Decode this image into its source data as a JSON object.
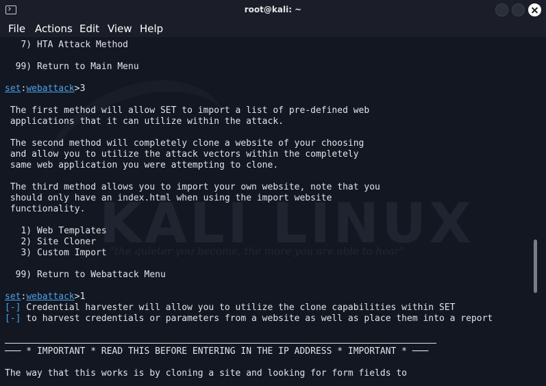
{
  "window": {
    "title": "root@kali: ~"
  },
  "menu": {
    "items": [
      "File",
      "Actions",
      "Edit",
      "View",
      "Help"
    ]
  },
  "watermark": {
    "logo": "KALI LINUX",
    "tagline": "\"the quieter you become, the more you are able to hear\""
  },
  "terminal": {
    "l00": "   7) HTA Attack Method",
    "l02": "  99) Return to Main Menu",
    "prompt_set": "set",
    "prompt_colon": ":",
    "prompt_module": "webattack",
    "prompt1_input": ">3",
    "l06": " The first method will allow SET to import a list of pre-defined web",
    "l07": " applications that it can utilize within the attack.",
    "l09": " The second method will completely clone a website of your choosing",
    "l10": " and allow you to utilize the attack vectors within the completely",
    "l11": " same web application you were attempting to clone.",
    "l13": " The third method allows you to import your own website, note that you",
    "l14": " should only have an index.html when using the import website",
    "l15": " functionality.",
    "l17": "   1) Web Templates",
    "l18": "   2) Site Cloner",
    "l19": "   3) Custom Import",
    "l21": "  99) Return to Webattack Menu",
    "prompt2_input": ">1",
    "bracket": "[-]",
    "l24": " Credential harvester will allow you to utilize the clone capabilities within SET",
    "l25": " to harvest credentials or parameters from a website as well as place them into a report",
    "l28": "─── * IMPORTANT * READ THIS BEFORE ENTERING IN THE IP ADDRESS * IMPORTANT * ───",
    "l30": "The way that this works is by cloning a site and looking for form fields to"
  }
}
